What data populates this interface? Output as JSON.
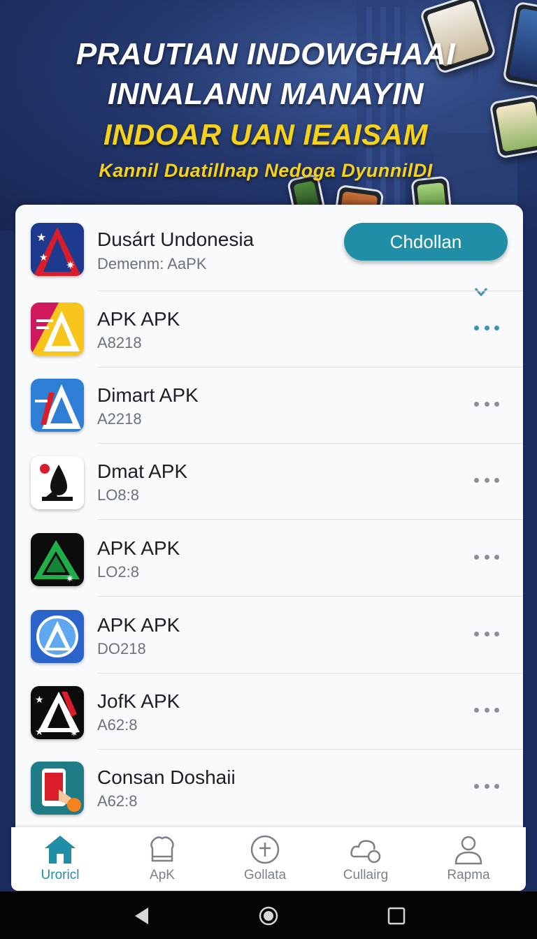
{
  "hero": {
    "line1": "PRAUTIAN INDOWGHAAI",
    "line2": "INNALANN MANAYIN",
    "line3": "INDOAR UAN IEAISAM",
    "line4": "Kannil Duatillnap Nedoga DyunnilDI"
  },
  "featured": {
    "name": "Dusárt Undonesia",
    "subtitle": "Demenm: AaPK",
    "button_label": "Chdollan",
    "icon": "app-logo-star-a-icon"
  },
  "apps": [
    {
      "name": "APK APK",
      "subtitle": "A8218",
      "icon": "app-logo-yellow-a-icon",
      "accent": "#3a95b8"
    },
    {
      "name": "Dimart APK",
      "subtitle": "A2218",
      "icon": "app-logo-blue-a-icon",
      "accent": "#8a9099"
    },
    {
      "name": "Dmat APK",
      "subtitle": "LO8:8",
      "icon": "app-logo-drop-icon",
      "accent": "#8a9099"
    },
    {
      "name": "APK APK",
      "subtitle": "LO2:8",
      "icon": "app-logo-green-triangle-icon",
      "accent": "#8a9099"
    },
    {
      "name": "APK APK",
      "subtitle": "DO218",
      "icon": "app-logo-circle-a-icon",
      "accent": "#8a9099"
    },
    {
      "name": "JofK APK",
      "subtitle": "A62:8",
      "icon": "app-logo-dark-a-icon",
      "accent": "#8a9099"
    },
    {
      "name": "Consan Doshaii",
      "subtitle": "A62:8",
      "icon": "app-logo-phone-hand-icon",
      "accent": "#8a9099"
    }
  ],
  "nav": {
    "items": [
      {
        "label": "Uroricl",
        "icon": "home-icon",
        "active": true
      },
      {
        "label": "ApK",
        "icon": "bag-icon",
        "active": false
      },
      {
        "label": "Gollata",
        "icon": "add-circle-icon",
        "active": false
      },
      {
        "label": "Cullairg",
        "icon": "cloud-sync-icon",
        "active": false
      },
      {
        "label": "Rapma",
        "icon": "profile-icon",
        "active": false
      }
    ]
  },
  "colors": {
    "accent": "#1f8ea6",
    "hero_yellow": "#f7d21b",
    "hero_bg": "#24386e"
  }
}
